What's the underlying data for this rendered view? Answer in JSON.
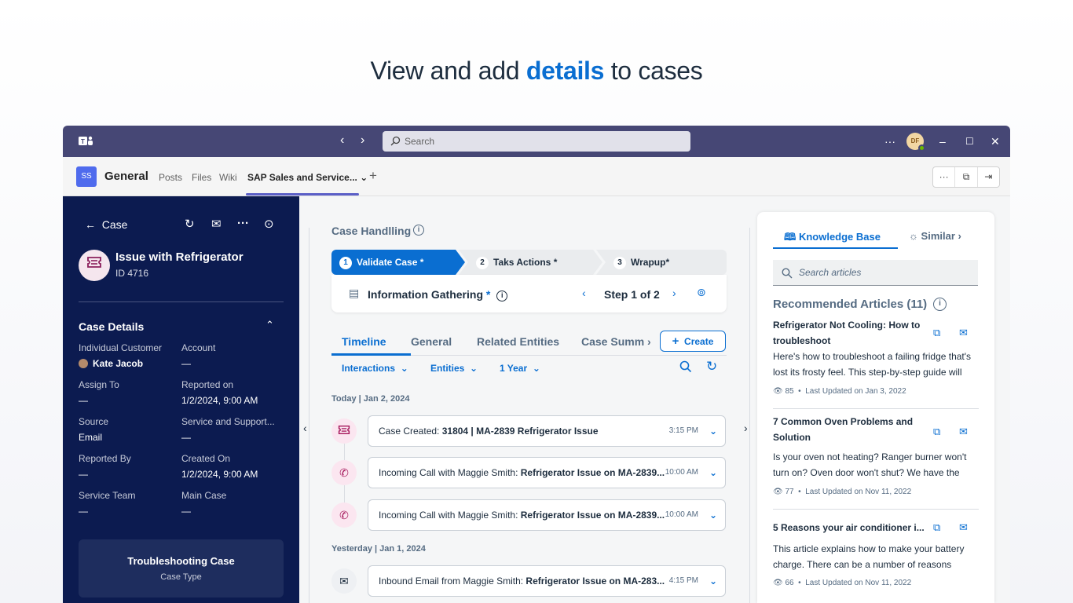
{
  "headline": {
    "pre": "View and add ",
    "highlight": "details",
    "post": " to cases"
  },
  "titlebar": {
    "search_placeholder": "Search",
    "more": "···",
    "avatar_initials": "DF",
    "minimize": "–",
    "maximize": "☐",
    "close": "✕"
  },
  "channel": {
    "badge": "SS",
    "name": "General",
    "tabs": [
      "Posts",
      "Files",
      "Wiki",
      "SAP Sales and Service..."
    ],
    "add": "+",
    "actions": [
      "···",
      "⧉",
      "⇥"
    ]
  },
  "left_panel": {
    "back_label": "Case",
    "case_title": "Issue with Refrigerator",
    "case_id": "ID 4716",
    "details_heading": "Case Details",
    "fields": [
      {
        "label": "Individual Customer",
        "value": "Kate Jacob"
      },
      {
        "label": "Account",
        "value": "—"
      },
      {
        "label": "Assign To",
        "value": "—"
      },
      {
        "label": "Reported on",
        "value": "1/2/2024, 9:00 AM"
      },
      {
        "label": "Source",
        "value": "Email"
      },
      {
        "label": "Service and Support...",
        "value": "—"
      },
      {
        "label": "Reported By",
        "value": "—"
      },
      {
        "label": "Created On",
        "value": "1/2/2024, 9:00 AM"
      },
      {
        "label": "Service Team",
        "value": "—"
      },
      {
        "label": "Main Case",
        "value": "—"
      }
    ],
    "case_type_value": "Troubleshooting Case",
    "case_type_label": "Case Type"
  },
  "middle": {
    "title": "Case Handlling",
    "steps": [
      {
        "num": "1",
        "label": "Validate Case *"
      },
      {
        "num": "2",
        "label": "Taks Actions *"
      },
      {
        "num": "3",
        "label": "Wrapup*"
      }
    ],
    "section_title": "Information Gathering",
    "required_mark": "*",
    "step_indicator": "Step 1 of 2",
    "tabs": [
      "Timeline",
      "General",
      "Related Entities",
      "Case Summ"
    ],
    "create_label": "Create",
    "filters": [
      "Interactions",
      "Entities",
      "1 Year"
    ],
    "days": [
      {
        "label": "Today | Jan 2, 2024",
        "items": [
          {
            "icon": "ticket-icon",
            "prefix": "Case Created: ",
            "bold": "31804 | MA-2839 Refrigerator Issue",
            "time": "3:15 PM"
          },
          {
            "icon": "phone-call-icon",
            "prefix": "Incoming Call with Maggie Smith: ",
            "bold": "Refrigerator Issue on MA-2839...",
            "time": "10:00 AM"
          },
          {
            "icon": "phone-call-icon",
            "prefix": "Incoming Call with Maggie Smith: ",
            "bold": "Refrigerator Issue on MA-2839...",
            "time": "10:00 AM"
          }
        ]
      },
      {
        "label": "Yesterday | Jan 1, 2024",
        "items": [
          {
            "icon": "inbound-email-icon",
            "prefix": "Inbound Email from Maggie Smith: ",
            "bold": "Refrigerator Issue on MA-283...",
            "time": "4:15 PM"
          }
        ]
      }
    ]
  },
  "right": {
    "tab_kb": "Knowledge Base",
    "tab_similar": "Similar",
    "search_placeholder": "Search articles",
    "rec_heading": "Recommended Articles (11)",
    "articles": [
      {
        "title": "Refrigerator Not Cooling: How to troubleshoot",
        "desc": "Here's how to troubleshoot a failing fridge that's lost its frosty feel. This step-by-step guide will sh...",
        "views": "85",
        "updated": "Last Updated on Jan 3, 2022"
      },
      {
        "title": "7 Common Oven Problems and Solution",
        "desc": "Is your oven not heating? Ranger burner won't turn on? Oven door won't shut? We have the sol...",
        "views": "77",
        "updated": "Last Updated on Nov 11, 2022"
      },
      {
        "title": "5 Reasons your air conditioner i...",
        "desc": "This article explains how to make your battery charge. There can be a number of reasons behin...",
        "views": "66",
        "updated": "Last Updated on Nov 11, 2022"
      }
    ]
  }
}
